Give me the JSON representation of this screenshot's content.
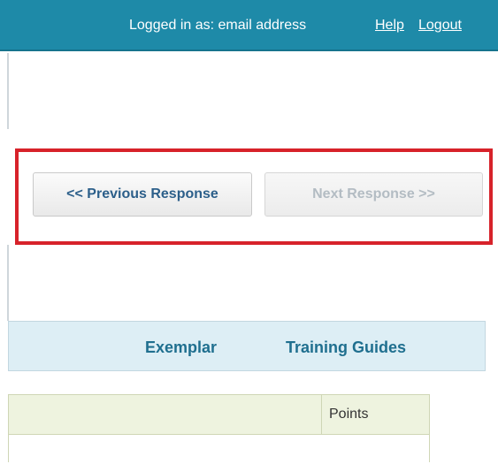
{
  "header": {
    "login_text": "Logged in as: email address",
    "help_label": "Help",
    "logout_label": "Logout"
  },
  "navigation": {
    "previous_label": "<< Previous Response",
    "next_label": "Next Response >>"
  },
  "tabs": [
    {
      "label": "Exemplar"
    },
    {
      "label": "Training Guides"
    }
  ],
  "table": {
    "columns": [
      "",
      "Points"
    ]
  },
  "colors": {
    "header_bg": "#1e8aa8",
    "highlight_border": "#d7222a",
    "tabs_bg": "#ddeef5",
    "table_header_bg": "#eef3df"
  }
}
